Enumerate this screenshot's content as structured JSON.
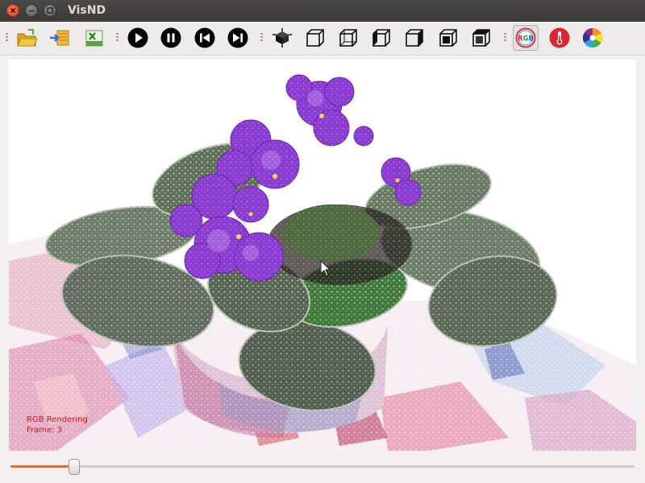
{
  "window": {
    "title": "VisND"
  },
  "toolbar": {
    "buttons": [
      {
        "icon": "open-folder-icon"
      },
      {
        "icon": "import-icon"
      },
      {
        "icon": "export-excel-icon"
      },
      {
        "icon": "play-icon"
      },
      {
        "icon": "pause-icon"
      },
      {
        "icon": "skip-previous-icon"
      },
      {
        "icon": "skip-next-icon"
      },
      {
        "icon": "axes-icon"
      },
      {
        "icon": "view-cube-icon"
      },
      {
        "icon": "rgb-icon",
        "label": "RGB",
        "active": true
      },
      {
        "icon": "thermometer-icon"
      },
      {
        "icon": "color-wheel-icon"
      }
    ]
  },
  "viewport": {
    "rendering_label": "RGB Rendering",
    "frame_label": "Frame: 3"
  },
  "timeline": {
    "position": 0.095
  },
  "colors": {
    "accent": "#ec6b3c",
    "overlay_text": "#c8191a"
  }
}
